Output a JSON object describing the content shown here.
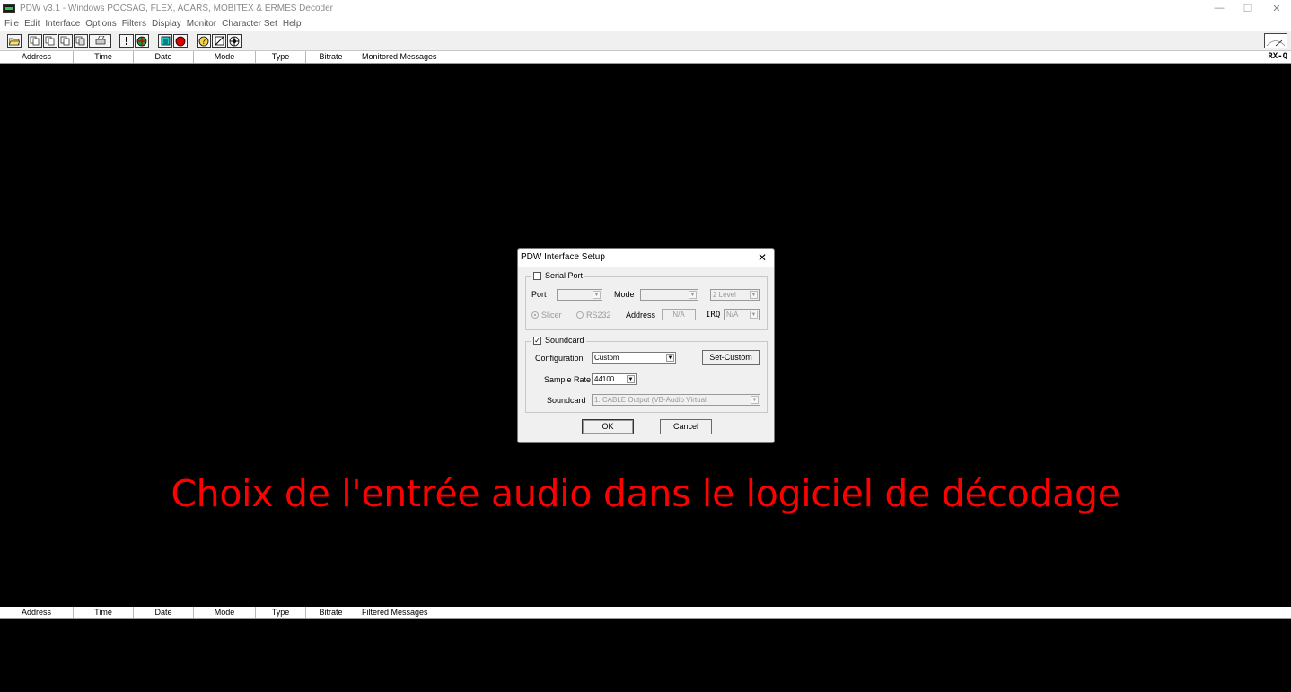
{
  "window": {
    "title": "PDW v3.1 - Windows POCSAG, FLEX, ACARS, MOBITEX & ERMES Decoder",
    "minimize": "—",
    "restore": "❐",
    "close": "✕"
  },
  "menu": [
    "File",
    "Edit",
    "Interface",
    "Options",
    "Filters",
    "Display",
    "Monitor",
    "Character Set",
    "Help"
  ],
  "toolbar": {
    "icons": [
      "open-folder-icon",
      "copy-icon",
      "copy-icon-2",
      "copy-icon-3",
      "copy-icon-4",
      "print-icon",
      "exclamation-icon",
      "globe-icon",
      "list-icon",
      "record-icon",
      "help-icon",
      "mute-icon",
      "target-icon"
    ]
  },
  "monitored_header": {
    "columns": [
      "Address",
      "Time",
      "Date",
      "Mode",
      "Type",
      "Bitrate",
      "Monitored Messages"
    ],
    "rxq": "RX-Q"
  },
  "filtered_header": {
    "columns": [
      "Address",
      "Time",
      "Date",
      "Mode",
      "Type",
      "Bitrate",
      "Filtered Messages"
    ]
  },
  "caption": "Choix de l'entrée audio dans le logiciel de décodage",
  "dialog": {
    "title": "PDW Interface Setup",
    "close": "✕",
    "serial": {
      "label": "Serial Port",
      "checked": false,
      "port_label": "Port",
      "port_value": "",
      "mode_label": "Mode",
      "mode_value": "",
      "level_value": "2 Level",
      "slicer_label": "Slicer",
      "rs232_label": "RS232",
      "address_label": "Address",
      "address_value": "N/A",
      "irq_label": "IRQ",
      "irq_value": "N/A"
    },
    "soundcard": {
      "label": "Soundcard",
      "checked": true,
      "check_mark": "✓",
      "configuration_label": "Configuration",
      "configuration_value": "Custom",
      "set_custom_label": "Set-Custom",
      "sample_rate_label": "Sample Rate",
      "sample_rate_value": "44100",
      "device_label": "Soundcard",
      "device_value": "1. CABLE Output (VB-Audio Virtual"
    },
    "ok_label": "OK",
    "cancel_label": "Cancel",
    "dropdown_arrow": "▼"
  }
}
